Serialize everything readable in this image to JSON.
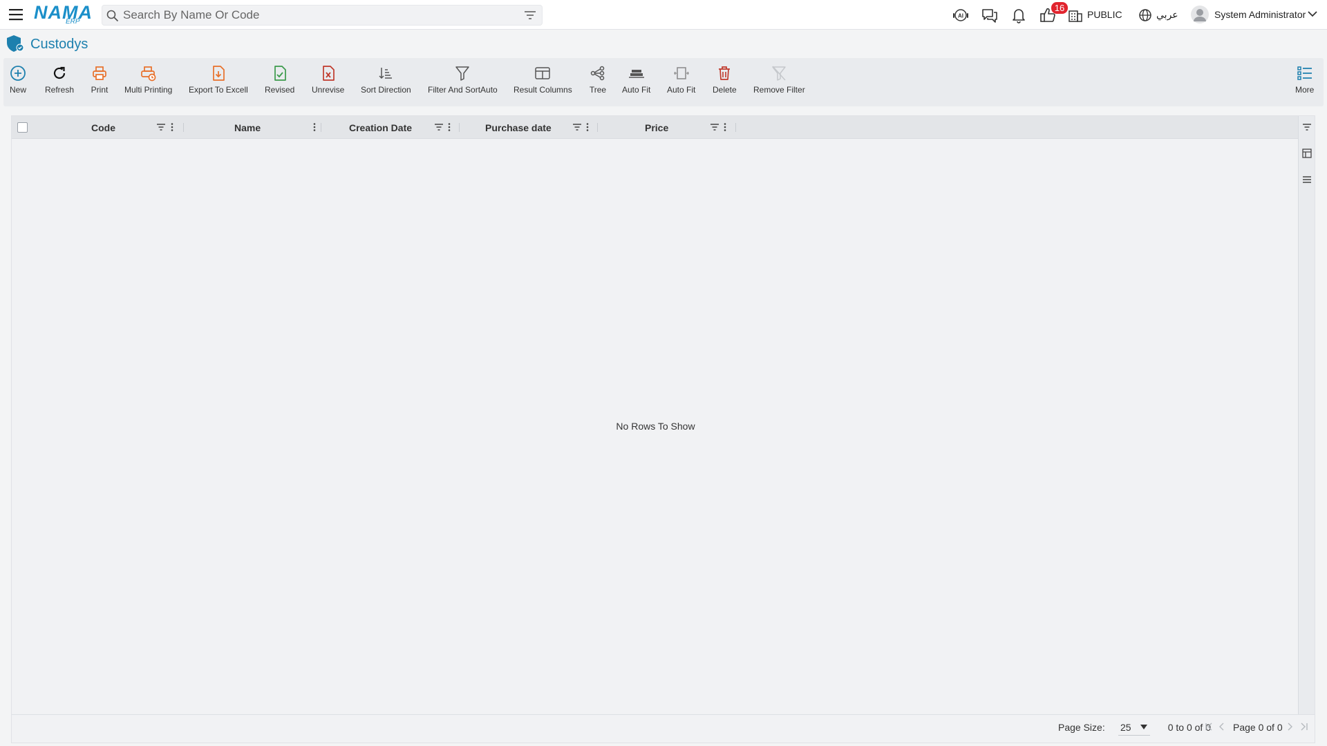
{
  "app": {
    "logo_text": "NAMA",
    "logo_sub": "ERP"
  },
  "search": {
    "placeholder": "Search By Name Or Code",
    "value": ""
  },
  "header": {
    "notification_count": "16",
    "branch": "PUBLIC",
    "language": "عربي",
    "user_name": "System Administrator"
  },
  "page": {
    "title": "Custodys"
  },
  "toolbar": {
    "new": "New",
    "refresh": "Refresh",
    "print": "Print",
    "multi_printing": "Multi Printing",
    "export_excel": "Export To Excell",
    "revised": "Revised",
    "unrevise": "Unrevise",
    "sort_direction": "Sort Direction",
    "filter_sort_auto": "Filter And SortAuto",
    "result_columns": "Result Columns",
    "tree": "Tree",
    "auto_fit_1": "Auto Fit",
    "auto_fit_2": "Auto Fit",
    "delete": "Delete",
    "remove_filter": "Remove Filter",
    "more": "More"
  },
  "grid": {
    "columns": [
      "Code",
      "Name",
      "Creation Date",
      "Purchase date",
      "Price"
    ],
    "empty_message": "No Rows To Show"
  },
  "footer": {
    "page_size_label": "Page Size:",
    "page_size": "25",
    "range": "0 to 0 of 0",
    "page_info": "Page 0 of 0"
  },
  "colors": {
    "brand": "#1b8fc9",
    "title": "#1d80ae",
    "badge": "#e1242e",
    "print_orange": "#e8702a",
    "revised_green": "#3a9a4a",
    "delete_red": "#c0392b"
  }
}
